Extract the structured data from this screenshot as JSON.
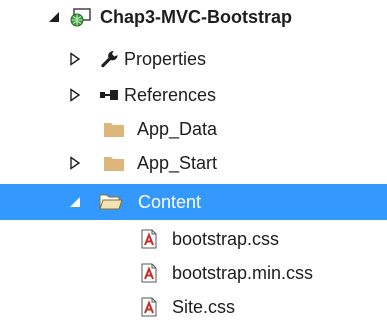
{
  "solution_explorer": {
    "project": {
      "label": "Chap3-MVC-Bootstrap",
      "expanded": true,
      "icon": "web-project-icon"
    },
    "items": [
      {
        "label": "Properties",
        "icon": "wrench-icon",
        "expanded": false
      },
      {
        "label": "References",
        "icon": "references-icon",
        "expanded": false
      },
      {
        "label": "App_Data",
        "icon": "folder-icon"
      },
      {
        "label": "App_Start",
        "icon": "folder-icon",
        "expanded": false
      },
      {
        "label": "Content",
        "icon": "folder-open-icon",
        "expanded": true,
        "selected": true
      },
      {
        "label": "bootstrap.css",
        "icon": "css-file-icon"
      },
      {
        "label": "bootstrap.min.css",
        "icon": "css-file-icon"
      },
      {
        "label": "Site.css",
        "icon": "css-file-icon"
      }
    ]
  },
  "colors": {
    "selection": "#3399ff",
    "folder": "#dcb67a",
    "css_file": "#c5302c"
  }
}
